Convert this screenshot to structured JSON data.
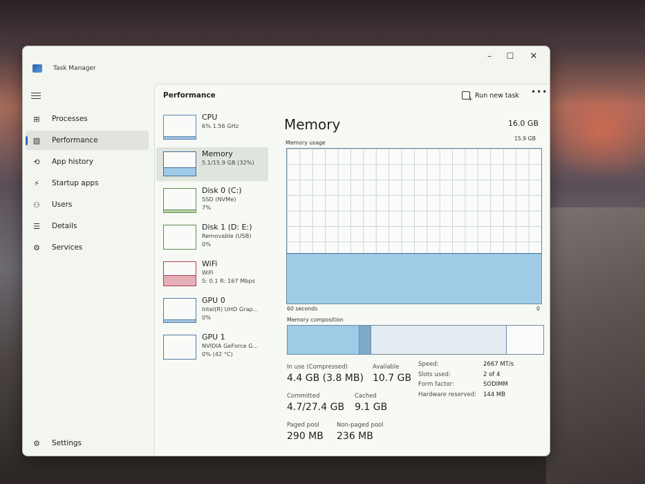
{
  "window": {
    "title": "Task Manager",
    "controls": {
      "minimize": "–",
      "maximize": "☐",
      "close": "✕"
    }
  },
  "sidebar": {
    "items": [
      {
        "label": "Processes",
        "icon": "processes-icon",
        "glyph": "⊞"
      },
      {
        "label": "Performance",
        "icon": "performance-icon",
        "glyph": "▧",
        "active": true
      },
      {
        "label": "App history",
        "icon": "history-icon",
        "glyph": "⟲"
      },
      {
        "label": "Startup apps",
        "icon": "startup-icon",
        "glyph": "⚡"
      },
      {
        "label": "Users",
        "icon": "users-icon",
        "glyph": "⚇"
      },
      {
        "label": "Details",
        "icon": "details-icon",
        "glyph": "☰"
      },
      {
        "label": "Services",
        "icon": "services-icon",
        "glyph": "⚙"
      }
    ],
    "settings": {
      "label": "Settings",
      "glyph": "⚙"
    }
  },
  "header": {
    "title": "Performance",
    "run_task": "Run new task",
    "more": "•••"
  },
  "resources": [
    {
      "name": "CPU",
      "line1": "6%  1.56 GHz",
      "line2": "",
      "fill": 0.06,
      "color": "#9fc0de",
      "border": "#5a87b5"
    },
    {
      "name": "Memory",
      "line1": "5.1/15.9 GB (32%)",
      "line2": "",
      "fill": 0.32,
      "color": "#9fcbe6",
      "border": "#3f6d9a",
      "selected": true
    },
    {
      "name": "Disk 0 (C:)",
      "line1": "SSD (NVMe)",
      "line2": "7%",
      "fill": 0.07,
      "color": "#b6d6a8",
      "border": "#5d8a4c"
    },
    {
      "name": "Disk 1 (D: E:)",
      "line1": "Removable (USB)",
      "line2": "0%",
      "fill": 0.0,
      "color": "#b6d6a8",
      "border": "#5d8a4c"
    },
    {
      "name": "WiFi",
      "line1": "WiFi",
      "line2": "S: 0.1  R: 167 Mbps",
      "fill": 0.4,
      "color": "#e7b0b8",
      "border": "#b03a4f"
    },
    {
      "name": "GPU 0",
      "line1": "Intel(R) UHD Grap...",
      "line2": "0%",
      "fill": 0.05,
      "color": "#a8c6e3",
      "border": "#4c7aa8"
    },
    {
      "name": "GPU 1",
      "line1": "NVIDIA GeForce G...",
      "line2": "0% (42 °C)",
      "fill": 0.0,
      "color": "#a8c6e3",
      "border": "#4c7aa8"
    }
  ],
  "memory": {
    "title": "Memory",
    "total": "16.0 GB",
    "usage_label": "Memory usage",
    "usage_max": "15.9 GB",
    "usage_fraction": 0.32,
    "time_left": "60 seconds",
    "time_right": "0",
    "composition_label": "Memory composition",
    "composition": [
      {
        "name": "In use",
        "fraction": 0.28,
        "color": "#9fcbe6"
      },
      {
        "name": "Modified",
        "fraction": 0.045,
        "color": "#7ea9c9"
      },
      {
        "name": "Standby",
        "fraction": 0.53,
        "color": "#e4ecf1"
      },
      {
        "name": "Free",
        "fraction": 0.145,
        "color": "#fbfcf9"
      }
    ],
    "stats": {
      "in_use_label": "In use (Compressed)",
      "in_use_value": "4.4 GB (3.8 MB)",
      "available_label": "Available",
      "available_value": "10.7 GB",
      "committed_label": "Committed",
      "committed_value": "4.7/27.4 GB",
      "cached_label": "Cached",
      "cached_value": "9.1 GB",
      "paged_label": "Paged pool",
      "paged_value": "290 MB",
      "nonpaged_label": "Non-paged pool",
      "nonpaged_value": "236 MB"
    },
    "details": [
      {
        "key": "Speed:",
        "value": "2667 MT/s"
      },
      {
        "key": "Slots used:",
        "value": "2 of 4"
      },
      {
        "key": "Form factor:",
        "value": "SODIMM"
      },
      {
        "key": "Hardware reserved:",
        "value": "144 MB"
      }
    ]
  }
}
